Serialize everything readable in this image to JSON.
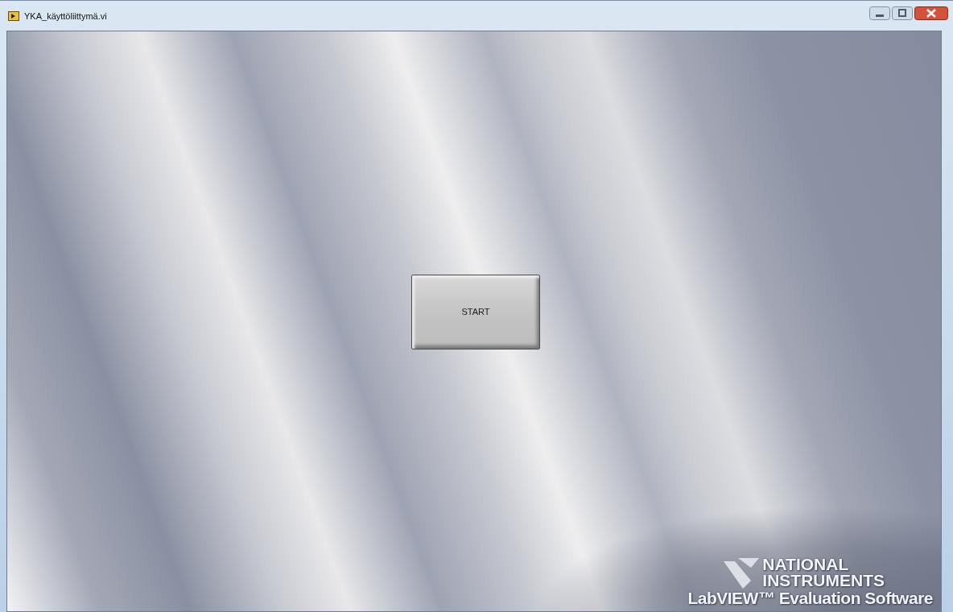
{
  "window": {
    "title": "YKA_käyttöliittymä.vi"
  },
  "front_panel": {
    "button": {
      "label": "START"
    },
    "evaluation_mark": {
      "brand_line_1": "NATIONAL",
      "brand_line_2": "INSTRUMENTS",
      "product": "LabVIEW™ Evaluation Software"
    }
  }
}
